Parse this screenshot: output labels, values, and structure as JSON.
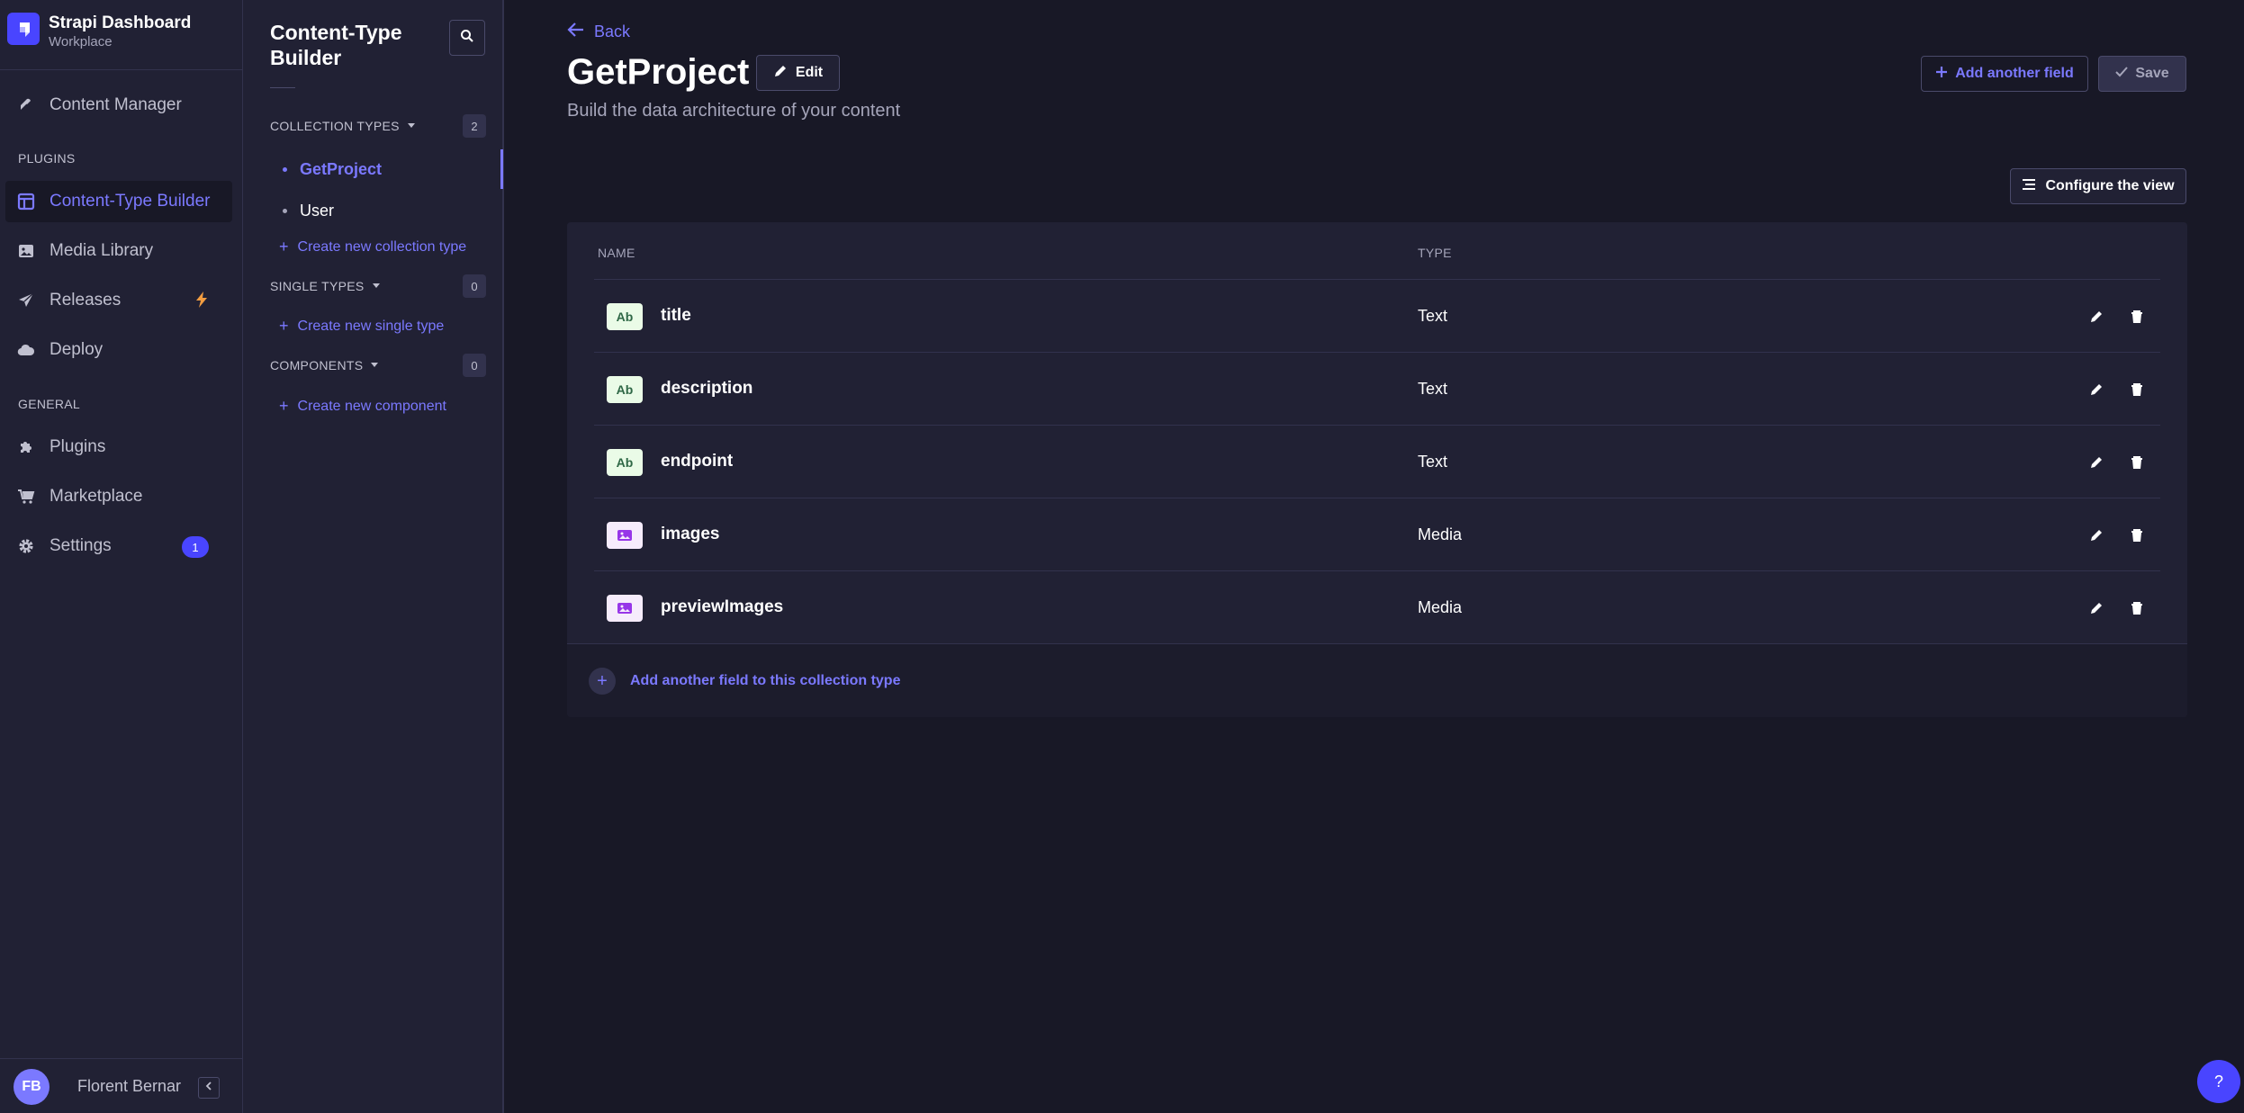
{
  "brand": {
    "title": "Strapi Dashboard",
    "subtitle": "Workplace"
  },
  "mainnav": {
    "content_manager": "Content Manager",
    "plugins_section": "PLUGINS",
    "content_type_builder": "Content-Type Builder",
    "media_library": "Media Library",
    "releases": "Releases",
    "deploy": "Deploy",
    "general_section": "GENERAL",
    "plugins": "Plugins",
    "marketplace": "Marketplace",
    "settings": "Settings",
    "settings_badge": "1"
  },
  "user": {
    "initials": "FB",
    "name": "Florent Bernar"
  },
  "subnav": {
    "title": "Content-Type Builder",
    "collection_types": {
      "label": "COLLECTION TYPES",
      "count": "2",
      "items": [
        "GetProject",
        "User"
      ],
      "create": "Create new collection type"
    },
    "single_types": {
      "label": "SINGLE TYPES",
      "count": "0",
      "create": "Create new single type"
    },
    "components": {
      "label": "COMPONENTS",
      "count": "0",
      "create": "Create new component"
    }
  },
  "header": {
    "back": "Back",
    "title": "GetProject",
    "edit": "Edit",
    "subtitle": "Build the data architecture of your content",
    "add_field": "Add another field",
    "save": "Save",
    "configure_view": "Configure the view"
  },
  "table": {
    "columns": {
      "name": "NAME",
      "type": "TYPE"
    },
    "rows": [
      {
        "badge": "Ab",
        "kind": "text",
        "name": "title",
        "type": "Text"
      },
      {
        "badge": "Ab",
        "kind": "text",
        "name": "description",
        "type": "Text"
      },
      {
        "badge": "Ab",
        "kind": "text",
        "name": "endpoint",
        "type": "Text"
      },
      {
        "badge": "",
        "kind": "media",
        "name": "images",
        "type": "Media"
      },
      {
        "badge": "",
        "kind": "media",
        "name": "previewImages",
        "type": "Media"
      }
    ],
    "footer_add": "Add another field to this collection type"
  },
  "help": "?",
  "colors": {
    "accent": "#7b79ff",
    "primary": "#4945ff",
    "background": "#181826",
    "surface": "#212134",
    "warning": "#f29d41"
  }
}
